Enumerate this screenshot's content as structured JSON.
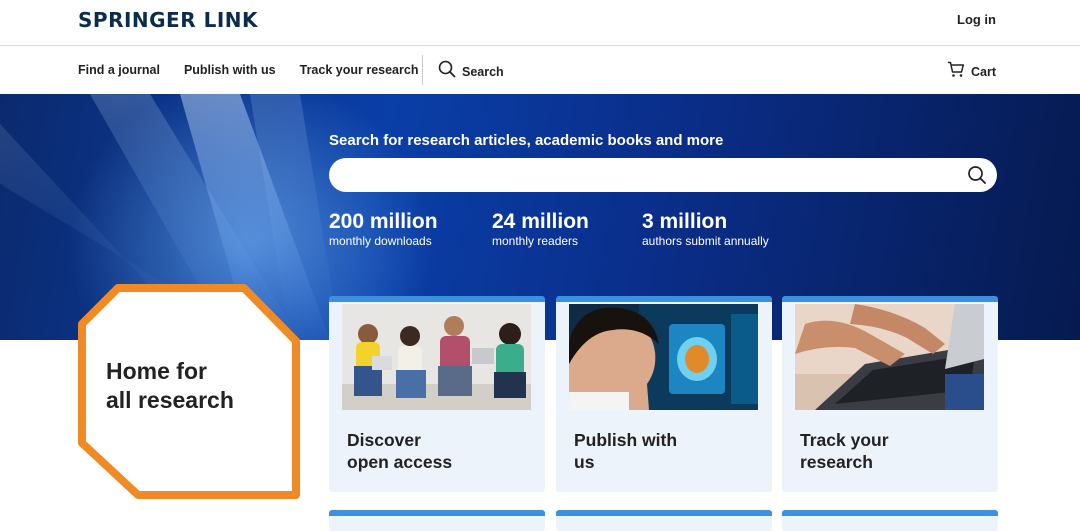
{
  "header": {
    "logo": "SPRINGER LINK",
    "login": "Log in"
  },
  "nav": {
    "links": [
      "Find a journal",
      "Publish with us",
      "Track your research"
    ],
    "search_label": "Search",
    "cart_label": "Cart"
  },
  "hero": {
    "heading": "Search for research articles, academic books and more",
    "search_placeholder": "",
    "stats": [
      {
        "number": "200 million",
        "label": "monthly downloads"
      },
      {
        "number": "24 million",
        "label": "monthly readers"
      },
      {
        "number": "3 million",
        "label": "authors submit annually"
      }
    ]
  },
  "feature": {
    "line1": "Home for",
    "line2": "all research"
  },
  "cards": [
    {
      "line1": "Discover",
      "line2": "open access"
    },
    {
      "line1": "Publish with",
      "line2": "us"
    },
    {
      "line1": "Track your",
      "line2": "research"
    }
  ],
  "colors": {
    "brand_navy": "#0c2c4d",
    "hero_blue": "#0a3fa8",
    "accent_orange": "#f08a24",
    "card_bg": "#edf3fa",
    "card_accent": "#3d8fe0"
  }
}
